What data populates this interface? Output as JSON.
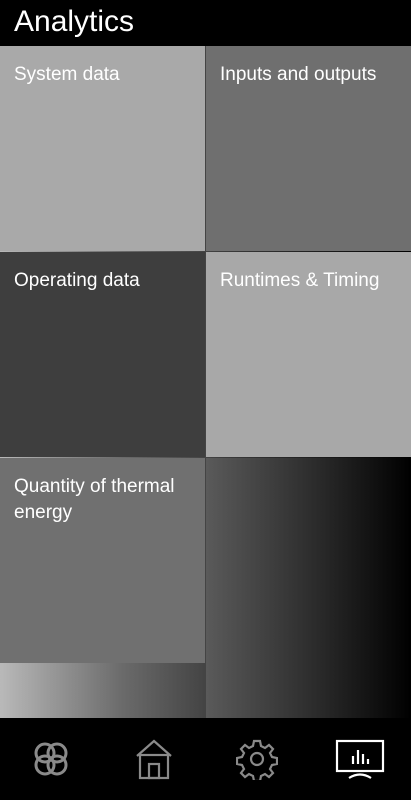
{
  "header": {
    "title": "Analytics"
  },
  "tiles": [
    {
      "label": "System data"
    },
    {
      "label": "Inputs and outputs"
    },
    {
      "label": "Operating data"
    },
    {
      "label": "Runtimes & Timing"
    },
    {
      "label": "Quantity of thermal energy"
    }
  ],
  "nav": {
    "items": [
      {
        "icon": "knot-logo-icon"
      },
      {
        "icon": "home-icon"
      },
      {
        "icon": "gear-icon"
      },
      {
        "icon": "analytics-monitor-icon",
        "active": true
      }
    ]
  },
  "colors": {
    "background": "#000000",
    "text": "#ffffff",
    "icon": "#888888",
    "icon_active": "#ffffff"
  }
}
